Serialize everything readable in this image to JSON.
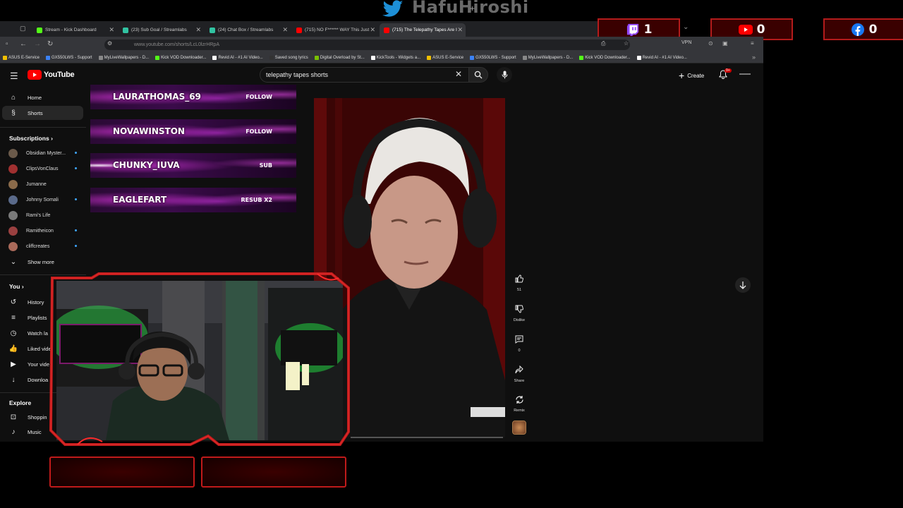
{
  "overlay": {
    "streamer_name": "HafuHiroshi",
    "counters": [
      {
        "platform": "twitch",
        "icon": "twitch-icon",
        "value": "1"
      },
      {
        "platform": "youtube",
        "icon": "youtube-icon",
        "value": "0"
      },
      {
        "platform": "facebook",
        "icon": "facebook-icon",
        "value": "0"
      }
    ],
    "alerts": [
      {
        "user": "LAURATHOMAS_69",
        "action": "FOLLOW"
      },
      {
        "user": "NOVAWINSTON",
        "action": "FOLLOW"
      },
      {
        "user": "CHUNKY_IUVA",
        "action": "SUB"
      },
      {
        "user": "EAGLEFART",
        "action": "RESUB X2"
      }
    ],
    "accent_color": "#c01a1a"
  },
  "browser": {
    "tabs": [
      {
        "title": "Stream - Kick Dashboard",
        "fav": "#53fc18"
      },
      {
        "title": "(23) Sub Goal / Streamlabs",
        "fav": "#31c3a2"
      },
      {
        "title": "(24) Chat Box / Streamlabs",
        "fav": "#31c3a2"
      },
      {
        "title": "(715) NO F****** WAY This Just",
        "fav": "#ff0000"
      },
      {
        "title": "(715) The Telepathy Tapes Are I",
        "fav": "#ff0000"
      }
    ],
    "url": "www.youtube.com/shorts/LcL0lzrHRpA",
    "vpn_label": "VPN",
    "bookmarks": [
      {
        "label": "ASUS E-Service",
        "color": "#f0c000"
      },
      {
        "label": "GX550LWS - Support",
        "color": "#3b82f6"
      },
      {
        "label": "MyLiveWallpapers - D...",
        "color": "#888"
      },
      {
        "label": "Kick VOD Downloader...",
        "color": "#53fc18"
      },
      {
        "label": "Revid AI - #1 AI Video...",
        "color": "#fff"
      },
      {
        "label": "Saved song lyrics",
        "color": "#333"
      },
      {
        "label": "Digital Overload by St...",
        "color": "#79c000"
      },
      {
        "label": "KickTools - Widgets a...",
        "color": "#fff"
      },
      {
        "label": "ASUS E-Service",
        "color": "#f0c000"
      },
      {
        "label": "GX550LWS - Support",
        "color": "#3b82f6"
      },
      {
        "label": "MyLiveWallpapers - D...",
        "color": "#888"
      },
      {
        "label": "Kick VOD Downloader...",
        "color": "#53fc18"
      },
      {
        "label": "Revid AI - #1 AI Video...",
        "color": "#fff"
      }
    ]
  },
  "youtube": {
    "logo_text": "YouTube",
    "search_value": "telepathy tapes shorts",
    "create_label": "Create",
    "notif_badge": "9+",
    "nav": [
      {
        "label": "Home",
        "icon": "home-icon",
        "glyph": "⌂"
      },
      {
        "label": "Shorts",
        "icon": "shorts-icon",
        "glyph": "§"
      }
    ],
    "subscriptions_heading": "Subscriptions",
    "subscriptions": [
      {
        "name": "Obsidian Myster...",
        "color": "#6b5a4a"
      },
      {
        "name": "ClipsVonClaus",
        "color": "#a03030"
      },
      {
        "name": "Jumanne",
        "color": "#8a6a4a"
      },
      {
        "name": "Johnny Somali",
        "color": "#5a6a8a"
      },
      {
        "name": "Rami's Life",
        "color": "#7a7a7a"
      },
      {
        "name": "Ramitheicon",
        "color": "#9a4040"
      },
      {
        "name": "cliffcreates",
        "color": "#aa6a5a"
      }
    ],
    "show_more": "Show more",
    "you_heading": "You",
    "you_items": [
      {
        "label": "History",
        "glyph": "↺"
      },
      {
        "label": "Playlists",
        "glyph": "≡"
      },
      {
        "label": "Watch la",
        "glyph": "◷"
      },
      {
        "label": "Liked vide",
        "glyph": "👍"
      },
      {
        "label": "Your vide",
        "glyph": "▶"
      },
      {
        "label": "Downloa",
        "glyph": "↓"
      }
    ],
    "explore_heading": "Explore",
    "explore_items": [
      {
        "label": "Shoppin",
        "glyph": "⊡"
      },
      {
        "label": "Music",
        "glyph": "♪"
      }
    ],
    "short": {
      "actions": [
        {
          "name": "like-button",
          "icon": "thumbs-up-icon",
          "label": "51"
        },
        {
          "name": "dislike-button",
          "icon": "thumbs-down-icon",
          "label": "Dislike"
        },
        {
          "name": "comments-button",
          "icon": "comment-icon",
          "label": "0"
        },
        {
          "name": "share-button",
          "icon": "share-icon",
          "label": "Share"
        },
        {
          "name": "remix-button",
          "icon": "remix-icon",
          "label": "Remix"
        }
      ],
      "progress": 0
    }
  }
}
